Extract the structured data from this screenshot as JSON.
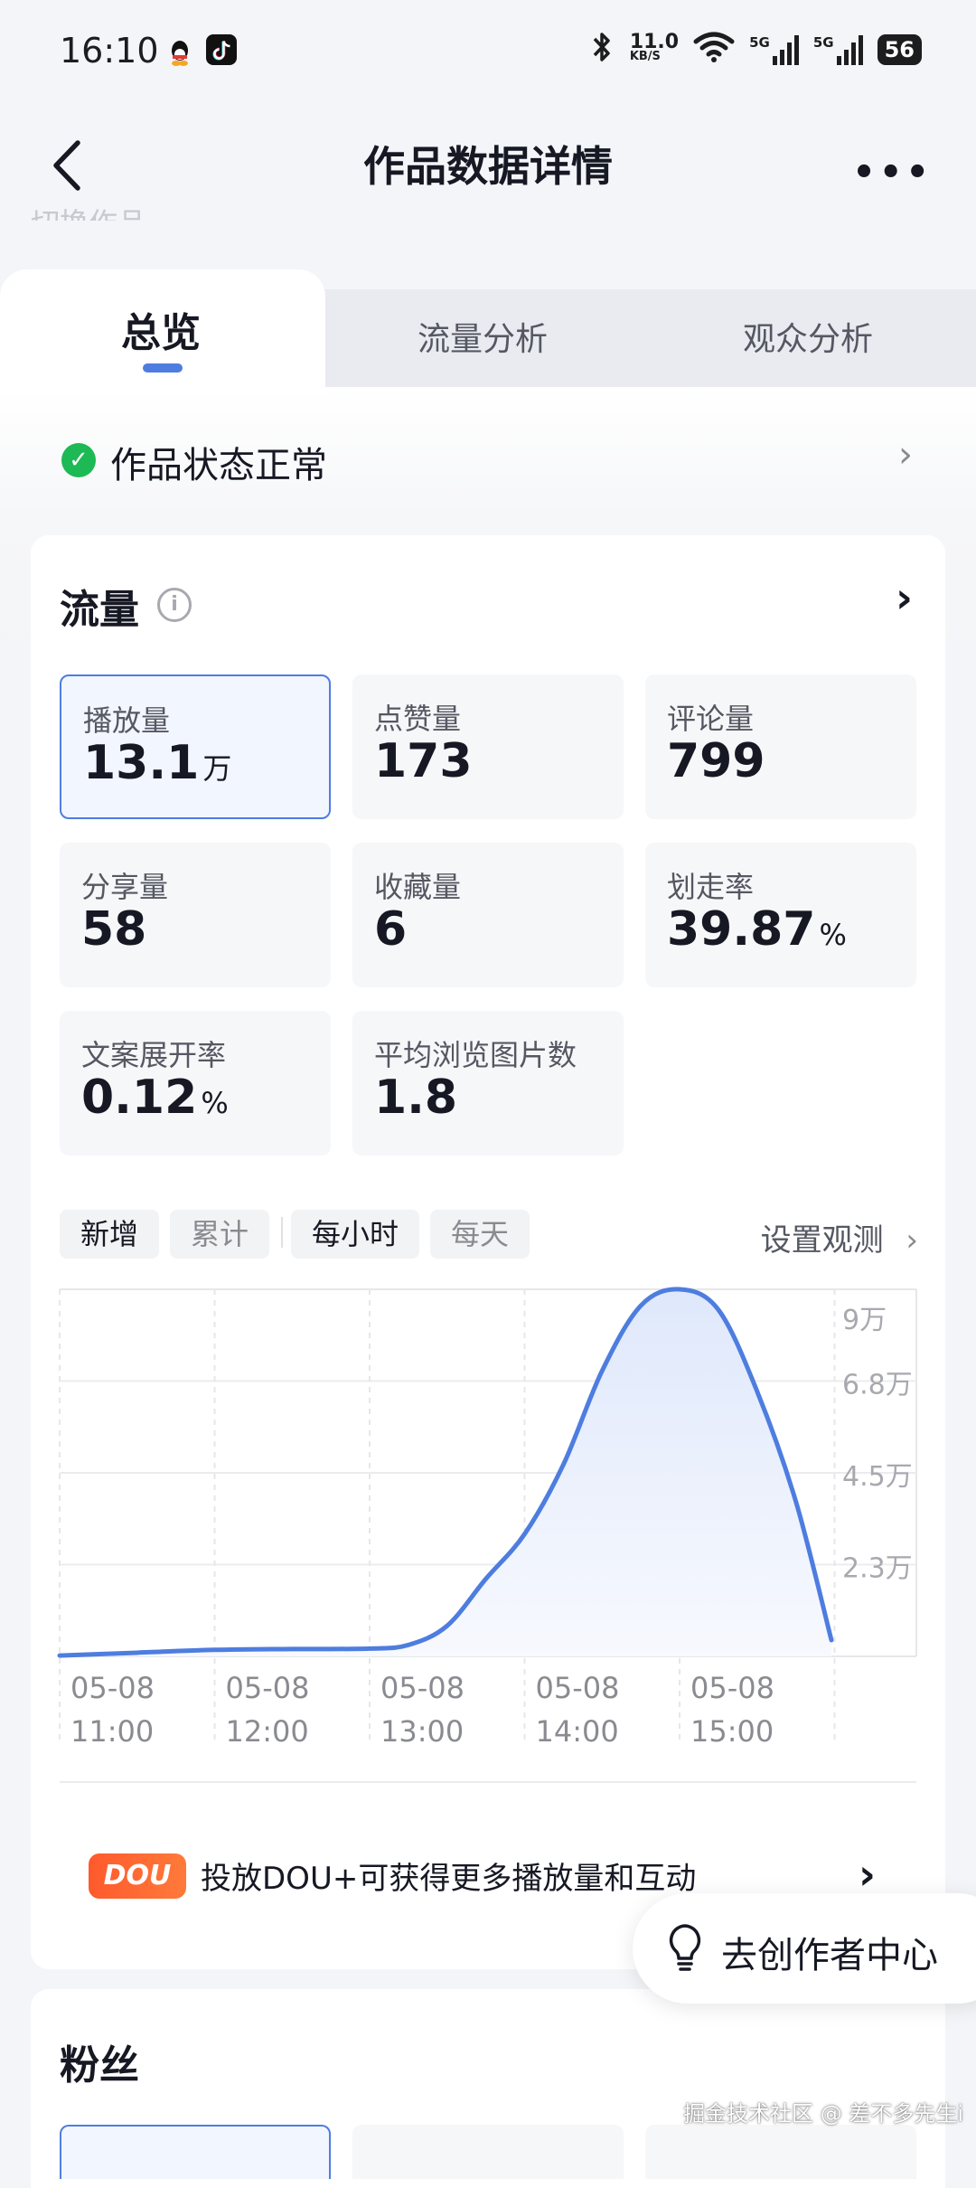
{
  "status_bar": {
    "time": "16:10",
    "net_speed_value": "11.0",
    "net_speed_unit": "KB/S",
    "signal1": "5G",
    "signal2": "5G",
    "battery": "56",
    "apps": [
      "qq-icon",
      "tiktok-icon"
    ],
    "icons": [
      "bluetooth-icon",
      "wifi-icon",
      "signal-icon",
      "battery-icon"
    ]
  },
  "nav": {
    "title": "作品数据详情",
    "back_icon": "chevron-left-icon",
    "more_icon": "more-icon",
    "more_label": "•••",
    "ghost_text": "切换作品"
  },
  "tabs": [
    {
      "label": "总览",
      "active": true
    },
    {
      "label": "流量分析",
      "active": false
    },
    {
      "label": "观众分析",
      "active": false
    }
  ],
  "work_status": {
    "text": "作品状态正常",
    "check": "✓",
    "chevron": "›"
  },
  "traffic": {
    "title": "流量",
    "info": "i",
    "chevron": "›",
    "metrics": [
      {
        "label": "播放量",
        "value": "13.1",
        "unit": "万",
        "selected": true
      },
      {
        "label": "点赞量",
        "value": "173",
        "unit": ""
      },
      {
        "label": "评论量",
        "value": "799",
        "unit": ""
      },
      {
        "label": "分享量",
        "value": "58",
        "unit": ""
      },
      {
        "label": "收藏量",
        "value": "6",
        "unit": ""
      },
      {
        "label": "划走率",
        "value": "39.87",
        "unit": "%"
      },
      {
        "label": "文案展开率",
        "value": "0.12",
        "unit": "%"
      },
      {
        "label": "平均浏览图片数",
        "value": "1.8",
        "unit": ""
      }
    ],
    "mode_tabs": [
      {
        "label": "新增",
        "active": true
      },
      {
        "label": "累计",
        "active": false
      }
    ],
    "interval_tabs": [
      {
        "label": "每小时",
        "active": true
      },
      {
        "label": "每天",
        "active": false
      }
    ],
    "settings_link": "设置观测",
    "settings_chevron": "›"
  },
  "chart_data": {
    "type": "area",
    "title": "",
    "xlabel": "",
    "ylabel": "",
    "x_ticks": [
      {
        "date": "05-08",
        "time": "11:00"
      },
      {
        "date": "05-08",
        "time": "12:00"
      },
      {
        "date": "05-08",
        "time": "13:00"
      },
      {
        "date": "05-08",
        "time": "14:00"
      },
      {
        "date": "05-08",
        "time": "15:00"
      }
    ],
    "y_ticks": [
      "9万",
      "6.8万",
      "4.5万",
      "2.3万"
    ],
    "y_tick_values": [
      90000,
      67500,
      45000,
      22500
    ],
    "ylim": [
      0,
      90000
    ],
    "grid": true,
    "color": "#4e7de0",
    "series": [
      {
        "x": [
          "11:00",
          "11:30",
          "12:00",
          "12:30",
          "13:00",
          "13:15",
          "13:30",
          "13:45",
          "14:00",
          "14:15",
          "14:30",
          "14:45",
          "15:00",
          "15:15",
          "15:30",
          "15:45",
          "16:00"
        ],
        "values": [
          200,
          900,
          1600,
          1800,
          1900,
          2800,
          7500,
          19000,
          30000,
          47000,
          70000,
          86000,
          90000,
          85000,
          65000,
          38000,
          4000
        ]
      }
    ]
  },
  "promo": {
    "badge": "DOU",
    "text": "投放DOU+可获得更多播放量和互动",
    "chevron": "›"
  },
  "fab": {
    "label": "去创作者中心",
    "icon": "lightbulb-icon"
  },
  "fans": {
    "title": "粉丝"
  },
  "watermark": "掘金技术社区 @ 差不多先生i"
}
